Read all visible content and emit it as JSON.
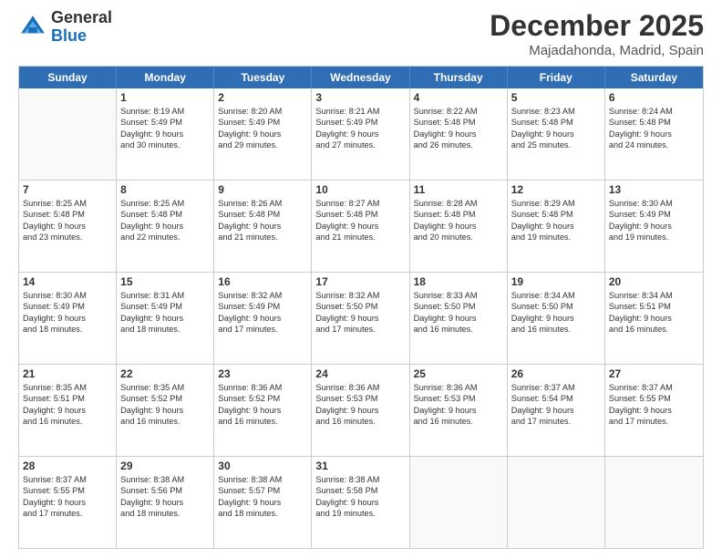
{
  "logo": {
    "general": "General",
    "blue": "Blue"
  },
  "title": "December 2025",
  "subtitle": "Majadahonda, Madrid, Spain",
  "days_of_week": [
    "Sunday",
    "Monday",
    "Tuesday",
    "Wednesday",
    "Thursday",
    "Friday",
    "Saturday"
  ],
  "weeks": [
    [
      {
        "day": "",
        "lines": []
      },
      {
        "day": "1",
        "lines": [
          "Sunrise: 8:19 AM",
          "Sunset: 5:49 PM",
          "Daylight: 9 hours",
          "and 30 minutes."
        ]
      },
      {
        "day": "2",
        "lines": [
          "Sunrise: 8:20 AM",
          "Sunset: 5:49 PM",
          "Daylight: 9 hours",
          "and 29 minutes."
        ]
      },
      {
        "day": "3",
        "lines": [
          "Sunrise: 8:21 AM",
          "Sunset: 5:49 PM",
          "Daylight: 9 hours",
          "and 27 minutes."
        ]
      },
      {
        "day": "4",
        "lines": [
          "Sunrise: 8:22 AM",
          "Sunset: 5:48 PM",
          "Daylight: 9 hours",
          "and 26 minutes."
        ]
      },
      {
        "day": "5",
        "lines": [
          "Sunrise: 8:23 AM",
          "Sunset: 5:48 PM",
          "Daylight: 9 hours",
          "and 25 minutes."
        ]
      },
      {
        "day": "6",
        "lines": [
          "Sunrise: 8:24 AM",
          "Sunset: 5:48 PM",
          "Daylight: 9 hours",
          "and 24 minutes."
        ]
      }
    ],
    [
      {
        "day": "7",
        "lines": [
          "Sunrise: 8:25 AM",
          "Sunset: 5:48 PM",
          "Daylight: 9 hours",
          "and 23 minutes."
        ]
      },
      {
        "day": "8",
        "lines": [
          "Sunrise: 8:25 AM",
          "Sunset: 5:48 PM",
          "Daylight: 9 hours",
          "and 22 minutes."
        ]
      },
      {
        "day": "9",
        "lines": [
          "Sunrise: 8:26 AM",
          "Sunset: 5:48 PM",
          "Daylight: 9 hours",
          "and 21 minutes."
        ]
      },
      {
        "day": "10",
        "lines": [
          "Sunrise: 8:27 AM",
          "Sunset: 5:48 PM",
          "Daylight: 9 hours",
          "and 21 minutes."
        ]
      },
      {
        "day": "11",
        "lines": [
          "Sunrise: 8:28 AM",
          "Sunset: 5:48 PM",
          "Daylight: 9 hours",
          "and 20 minutes."
        ]
      },
      {
        "day": "12",
        "lines": [
          "Sunrise: 8:29 AM",
          "Sunset: 5:48 PM",
          "Daylight: 9 hours",
          "and 19 minutes."
        ]
      },
      {
        "day": "13",
        "lines": [
          "Sunrise: 8:30 AM",
          "Sunset: 5:49 PM",
          "Daylight: 9 hours",
          "and 19 minutes."
        ]
      }
    ],
    [
      {
        "day": "14",
        "lines": [
          "Sunrise: 8:30 AM",
          "Sunset: 5:49 PM",
          "Daylight: 9 hours",
          "and 18 minutes."
        ]
      },
      {
        "day": "15",
        "lines": [
          "Sunrise: 8:31 AM",
          "Sunset: 5:49 PM",
          "Daylight: 9 hours",
          "and 18 minutes."
        ]
      },
      {
        "day": "16",
        "lines": [
          "Sunrise: 8:32 AM",
          "Sunset: 5:49 PM",
          "Daylight: 9 hours",
          "and 17 minutes."
        ]
      },
      {
        "day": "17",
        "lines": [
          "Sunrise: 8:32 AM",
          "Sunset: 5:50 PM",
          "Daylight: 9 hours",
          "and 17 minutes."
        ]
      },
      {
        "day": "18",
        "lines": [
          "Sunrise: 8:33 AM",
          "Sunset: 5:50 PM",
          "Daylight: 9 hours",
          "and 16 minutes."
        ]
      },
      {
        "day": "19",
        "lines": [
          "Sunrise: 8:34 AM",
          "Sunset: 5:50 PM",
          "Daylight: 9 hours",
          "and 16 minutes."
        ]
      },
      {
        "day": "20",
        "lines": [
          "Sunrise: 8:34 AM",
          "Sunset: 5:51 PM",
          "Daylight: 9 hours",
          "and 16 minutes."
        ]
      }
    ],
    [
      {
        "day": "21",
        "lines": [
          "Sunrise: 8:35 AM",
          "Sunset: 5:51 PM",
          "Daylight: 9 hours",
          "and 16 minutes."
        ]
      },
      {
        "day": "22",
        "lines": [
          "Sunrise: 8:35 AM",
          "Sunset: 5:52 PM",
          "Daylight: 9 hours",
          "and 16 minutes."
        ]
      },
      {
        "day": "23",
        "lines": [
          "Sunrise: 8:36 AM",
          "Sunset: 5:52 PM",
          "Daylight: 9 hours",
          "and 16 minutes."
        ]
      },
      {
        "day": "24",
        "lines": [
          "Sunrise: 8:36 AM",
          "Sunset: 5:53 PM",
          "Daylight: 9 hours",
          "and 16 minutes."
        ]
      },
      {
        "day": "25",
        "lines": [
          "Sunrise: 8:36 AM",
          "Sunset: 5:53 PM",
          "Daylight: 9 hours",
          "and 16 minutes."
        ]
      },
      {
        "day": "26",
        "lines": [
          "Sunrise: 8:37 AM",
          "Sunset: 5:54 PM",
          "Daylight: 9 hours",
          "and 17 minutes."
        ]
      },
      {
        "day": "27",
        "lines": [
          "Sunrise: 8:37 AM",
          "Sunset: 5:55 PM",
          "Daylight: 9 hours",
          "and 17 minutes."
        ]
      }
    ],
    [
      {
        "day": "28",
        "lines": [
          "Sunrise: 8:37 AM",
          "Sunset: 5:55 PM",
          "Daylight: 9 hours",
          "and 17 minutes."
        ]
      },
      {
        "day": "29",
        "lines": [
          "Sunrise: 8:38 AM",
          "Sunset: 5:56 PM",
          "Daylight: 9 hours",
          "and 18 minutes."
        ]
      },
      {
        "day": "30",
        "lines": [
          "Sunrise: 8:38 AM",
          "Sunset: 5:57 PM",
          "Daylight: 9 hours",
          "and 18 minutes."
        ]
      },
      {
        "day": "31",
        "lines": [
          "Sunrise: 8:38 AM",
          "Sunset: 5:58 PM",
          "Daylight: 9 hours",
          "and 19 minutes."
        ]
      },
      {
        "day": "",
        "lines": []
      },
      {
        "day": "",
        "lines": []
      },
      {
        "day": "",
        "lines": []
      }
    ]
  ]
}
